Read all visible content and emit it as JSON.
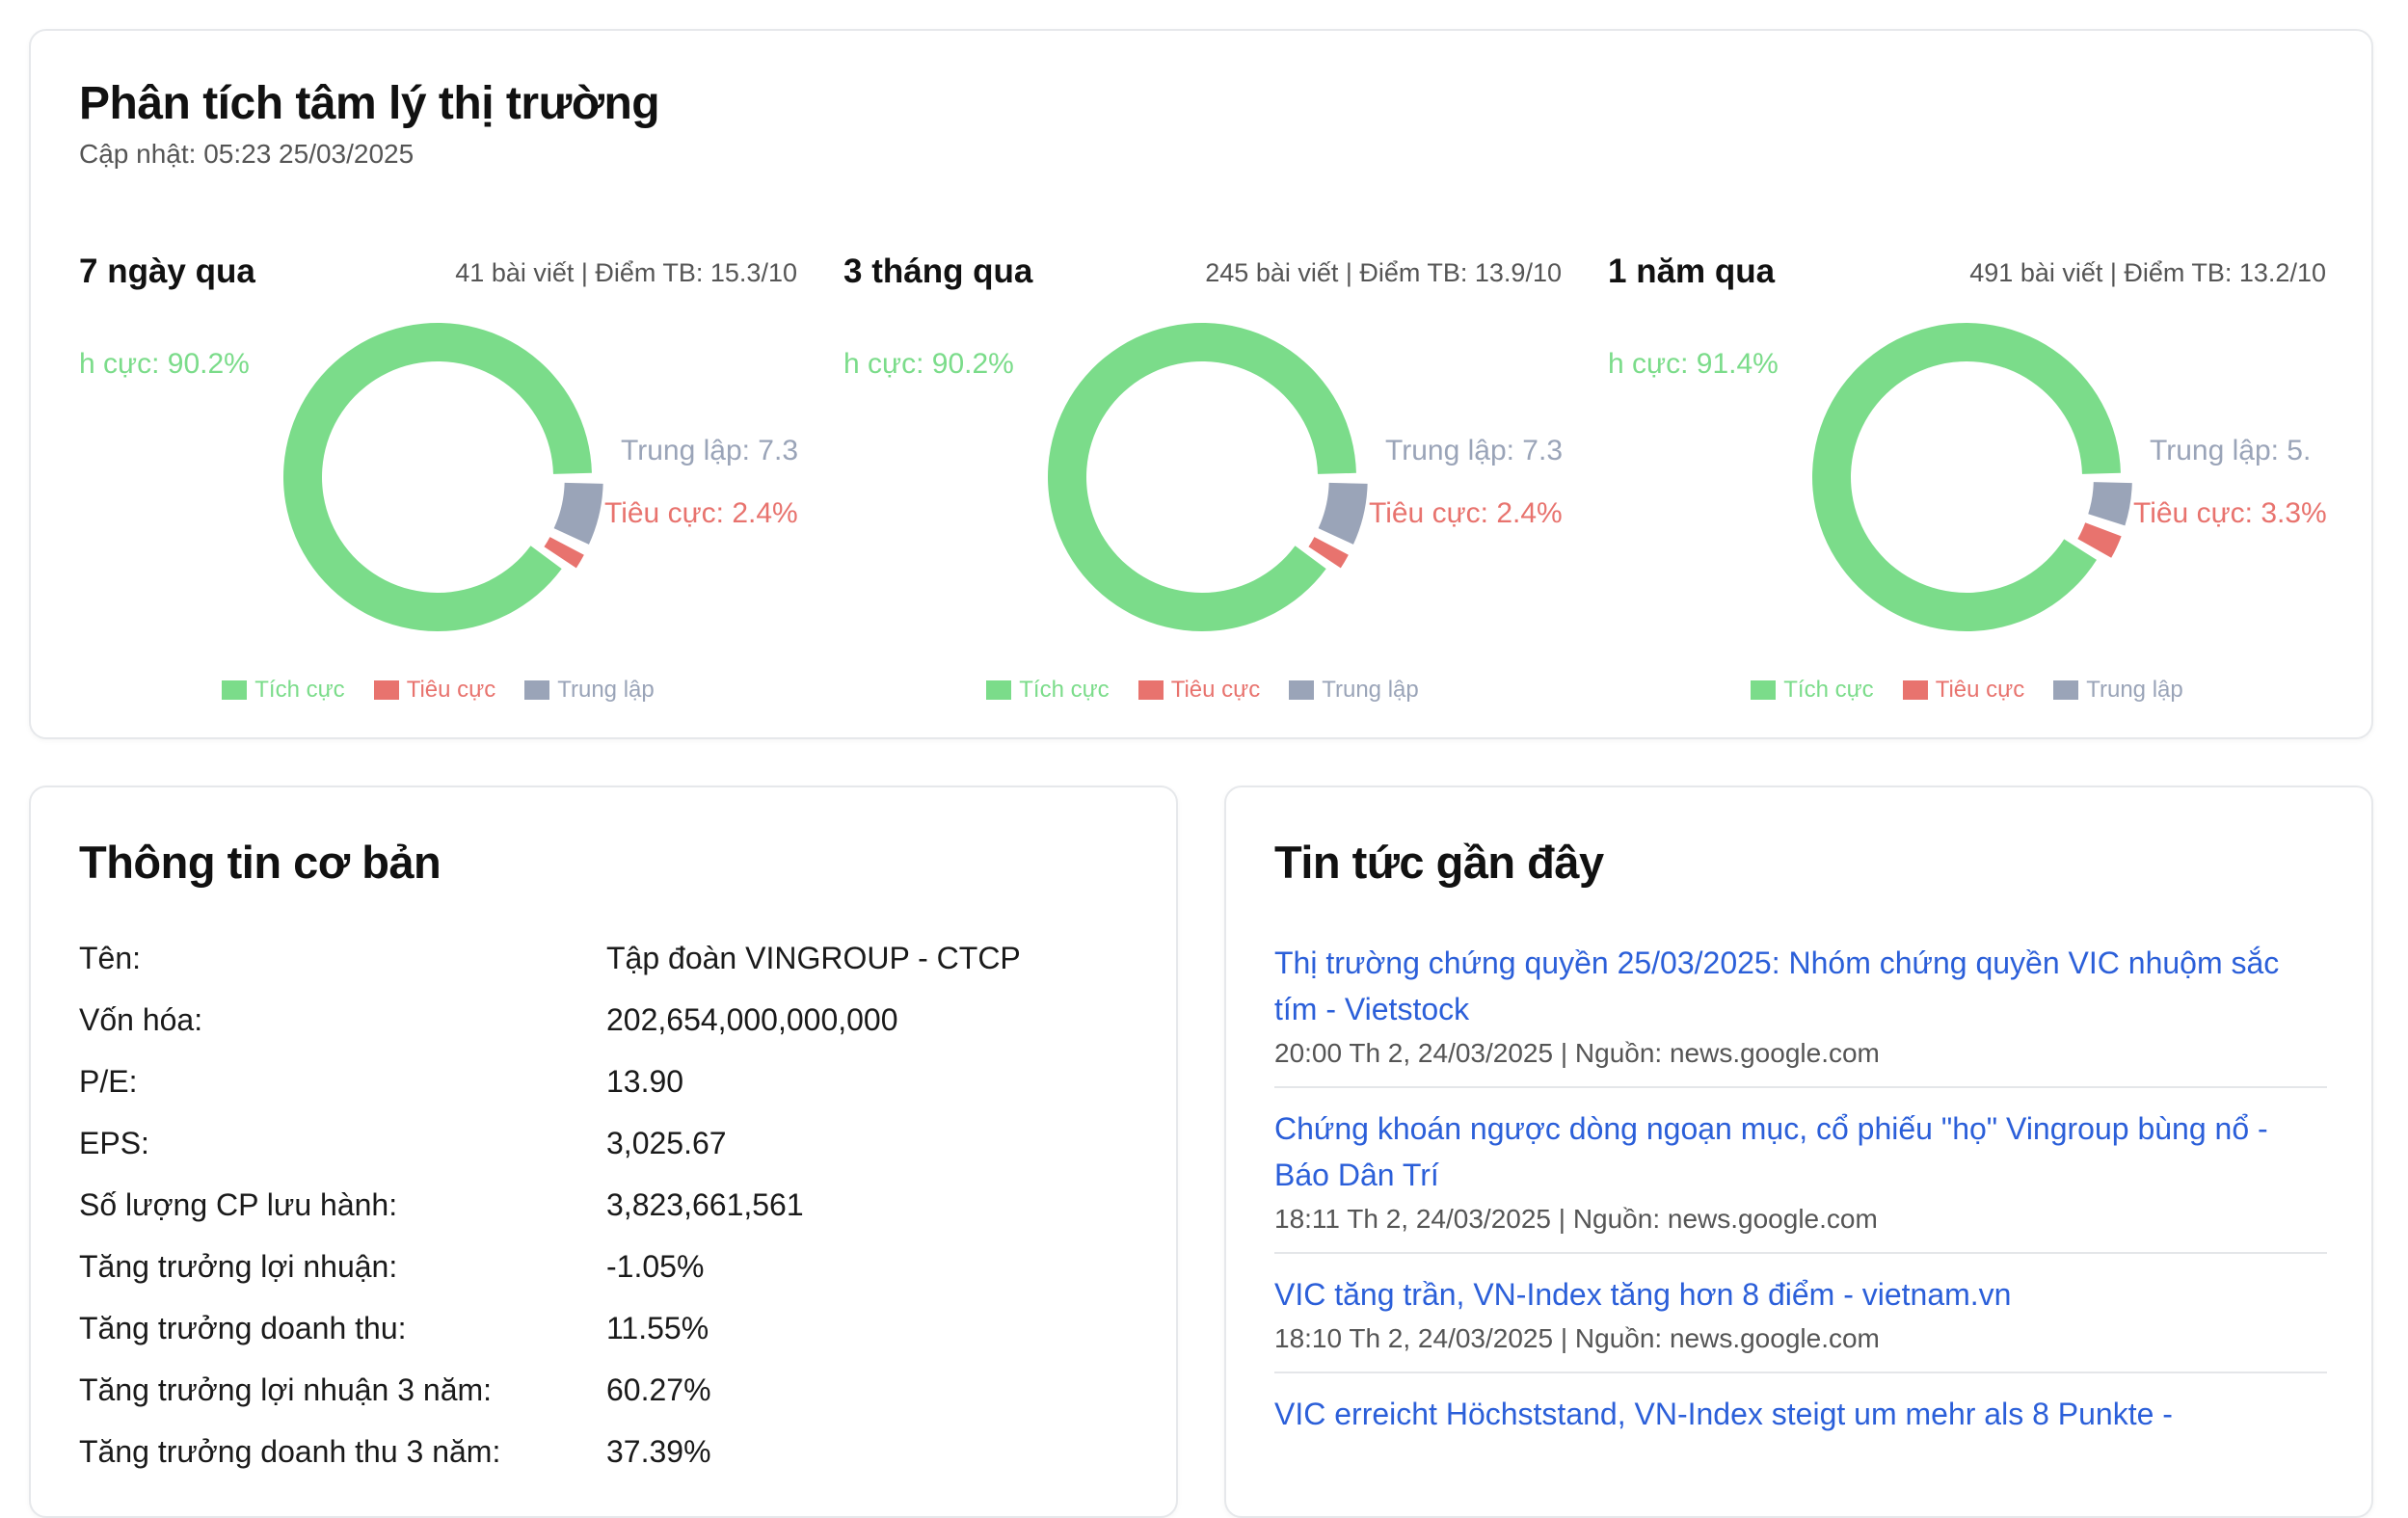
{
  "sentiment": {
    "title": "Phân tích tâm lý thị trường",
    "updated": "Cập nhật: 05:23 25/03/2025",
    "periods": [
      {
        "title": "7 ngày qua",
        "stats": "41 bài viết | Điểm TB: 15.3/10",
        "positive_pct": 90.2,
        "negative_pct": 2.4,
        "neutral_pct": 7.3,
        "label_positive": "h cực: 90.2%",
        "label_neutral": "Trung lập: 7.3",
        "label_negative": "Tiêu cực: 2.4%"
      },
      {
        "title": "3 tháng qua",
        "stats": "245 bài viết | Điểm TB: 13.9/10",
        "positive_pct": 90.2,
        "negative_pct": 2.4,
        "neutral_pct": 7.3,
        "label_positive": "h cực: 90.2%",
        "label_neutral": "Trung lập: 7.3",
        "label_negative": "Tiêu cực: 2.4%"
      },
      {
        "title": "1 năm qua",
        "stats": "491 bài viết | Điểm TB: 13.2/10",
        "positive_pct": 91.4,
        "negative_pct": 3.3,
        "neutral_pct": 5.3,
        "label_positive": "h cực: 91.4%",
        "label_neutral": "Trung lập: 5.",
        "label_negative": "Tiêu cực: 3.3%"
      }
    ],
    "legend": {
      "positive": "Tích cực",
      "negative": "Tiêu cực",
      "neutral": "Trung lập"
    },
    "colors": {
      "positive": "#7bdc8a",
      "negative": "#e8736e",
      "neutral": "#9aa4b8"
    }
  },
  "basic_info": {
    "title": "Thông tin cơ bản",
    "rows": [
      {
        "label": "Tên:",
        "value": "Tập đoàn VINGROUP - CTCP"
      },
      {
        "label": "Vốn hóa:",
        "value": "202,654,000,000,000"
      },
      {
        "label": "P/E:",
        "value": "13.90"
      },
      {
        "label": "EPS:",
        "value": "3,025.67"
      },
      {
        "label": "Số lượng CP lưu hành:",
        "value": "3,823,661,561"
      },
      {
        "label": "Tăng trưởng lợi nhuận:",
        "value": "-1.05%"
      },
      {
        "label": "Tăng trưởng doanh thu:",
        "value": "11.55%"
      },
      {
        "label": "Tăng trưởng lợi nhuận 3 năm:",
        "value": "60.27%"
      },
      {
        "label": "Tăng trưởng doanh thu 3 năm:",
        "value": "37.39%"
      }
    ]
  },
  "news": {
    "title": "Tin tức gần đây",
    "link_color": "#2b5fd9",
    "items": [
      {
        "title": "Thị trường chứng quyền 25/03/2025: Nhóm chứng quyền VIC nhuộm sắc tím - Vietstock",
        "meta": "20:00 Th 2, 24/03/2025 | Nguồn: news.google.com"
      },
      {
        "title": "Chứng khoán ngược dòng ngoạn mục, cổ phiếu \"họ\" Vingroup bùng nổ - Báo Dân Trí",
        "meta": "18:11 Th 2, 24/03/2025 | Nguồn: news.google.com"
      },
      {
        "title": "VIC tăng trần, VN-Index tăng hơn 8 điểm - vietnam.vn",
        "meta": "18:10 Th 2, 24/03/2025 | Nguồn: news.google.com"
      },
      {
        "title": "VIC erreicht Höchststand, VN-Index steigt um mehr als 8 Punkte -",
        "meta": ""
      }
    ]
  }
}
